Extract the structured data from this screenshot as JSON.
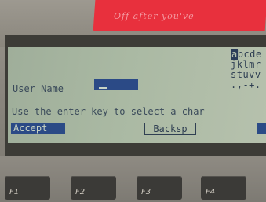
{
  "sticker": {
    "text": "Off after you've"
  },
  "screen": {
    "field_label": "User Name",
    "input_value": "",
    "instruction": "Use the enter key to select a char",
    "char_grid": {
      "selected": "a",
      "rows": [
        "bcde",
        "jklmr",
        "stuvv",
        ".,-+."
      ]
    },
    "softkeys": {
      "accept": "Accept",
      "backsp": "Backsp"
    }
  },
  "function_keys": [
    "F1",
    "F2",
    "F3",
    "F4"
  ]
}
